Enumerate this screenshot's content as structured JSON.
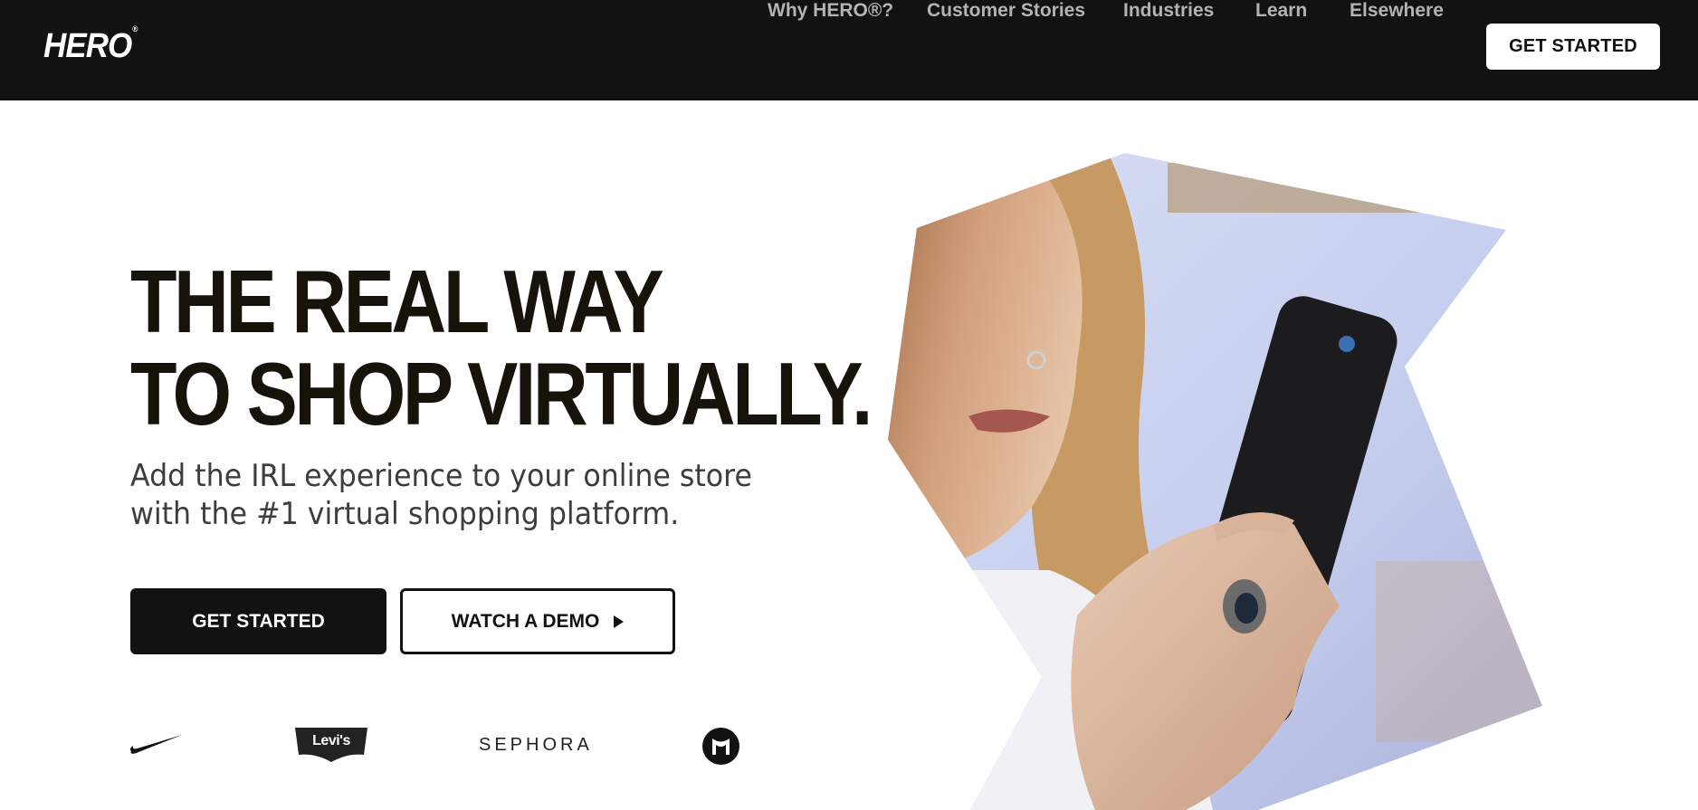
{
  "header": {
    "logo": "HERO",
    "logo_mark": "®",
    "nav": [
      {
        "label": "Why HERO®?"
      },
      {
        "label": "Customer Stories"
      },
      {
        "label": "Industries"
      },
      {
        "label": "Learn"
      },
      {
        "label": "Elsewhere"
      }
    ],
    "cta_label": "GET STARTED"
  },
  "hero": {
    "headline_line1": "THE REAL WAY",
    "headline_line2": "TO SHOP VIRTUALLY.",
    "subhead_line1": "Add the IRL experience to your online store",
    "subhead_line2": "with the #1 virtual shopping platform.",
    "primary_button": "GET STARTED",
    "secondary_button": "WATCH A DEMO",
    "secondary_button_icon": "play-icon",
    "image_icon": "woman-holding-phone-photo"
  },
  "brands": [
    {
      "icon": "nike-swoosh-logo"
    },
    {
      "label": "Levi's",
      "icon": "levis-logo"
    },
    {
      "label": "SEPHORA",
      "icon": "sephora-logo"
    },
    {
      "icon": "herman-miller-logo"
    }
  ],
  "colors": {
    "header_bg": "#121212",
    "nav_text": "#b3b3b3",
    "headline": "#15130a",
    "subhead": "#3d3d3d",
    "button_dark": "#121212",
    "levis_red": "#c41230"
  }
}
